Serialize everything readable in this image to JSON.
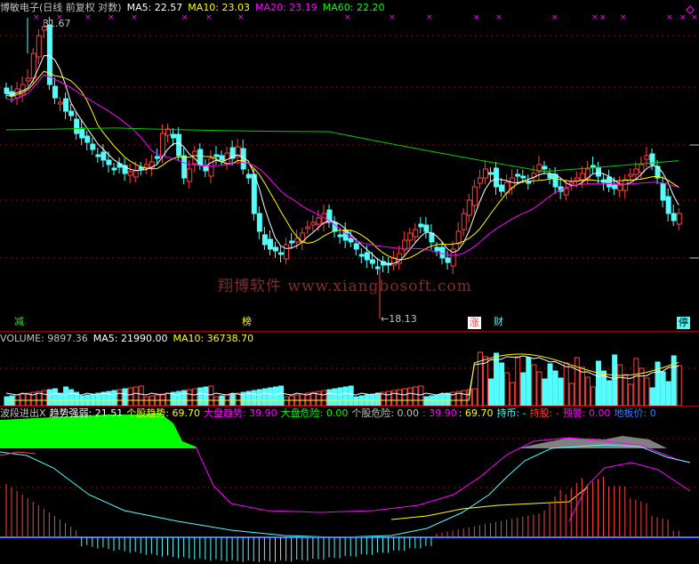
{
  "price_header": {
    "stock": "博敏电子(日线 前复权 对数)",
    "ma5": "MA5: 22.57",
    "ma10": "MA10: 23.03",
    "ma20": "MA20: 23.19",
    "ma60": "MA60: 22.20"
  },
  "price_labels": {
    "high": "31.67",
    "low": "←18.13"
  },
  "event_markers": {
    "a": "减",
    "b": "榜",
    "c": "涨",
    "d": "财",
    "e": "停"
  },
  "watermark": "翔博软件 www.xiangbosoft.com",
  "volume_header": {
    "volume": "VOLUME: 9897.36",
    "ma5": "MA5: 21990.00",
    "ma10": "MA10: 36738.70"
  },
  "indicator_header": {
    "name": "波段进出X",
    "trend": "趋势强弱: 21.51",
    "stock_trend": "个股趋势: 69.70",
    "market_trend": "大盘趋势: 39.90",
    "market_risk": "大盘危险: 0.00",
    "stock_risk": "个股危险: 0.00",
    "v1": ": 39.90",
    "v2": ": 69.70",
    "hold_coin": "持币: -",
    "hold_stock": "持股: -",
    "warning": "预警: 0.00",
    "floor": "地板价: 0"
  },
  "colors": {
    "up": "#ff4040",
    "down": "#54fcfc",
    "ma5": "#ffffff",
    "ma10": "#ffff00",
    "ma20": "#ff00ff",
    "ma60": "#00cc00",
    "grid": "#a00000"
  },
  "chart_data": {
    "type": "candlestick",
    "y_scale": "log",
    "price_range": [
      18.13,
      31.67
    ],
    "last_close": 22.57,
    "ma": {
      "MA5": 22.57,
      "MA10": 23.03,
      "MA20": 23.19,
      "MA60": 22.2
    },
    "volume": {
      "VOLUME": 9897.36,
      "MA5": 21990.0,
      "MA10": 36738.7
    }
  }
}
